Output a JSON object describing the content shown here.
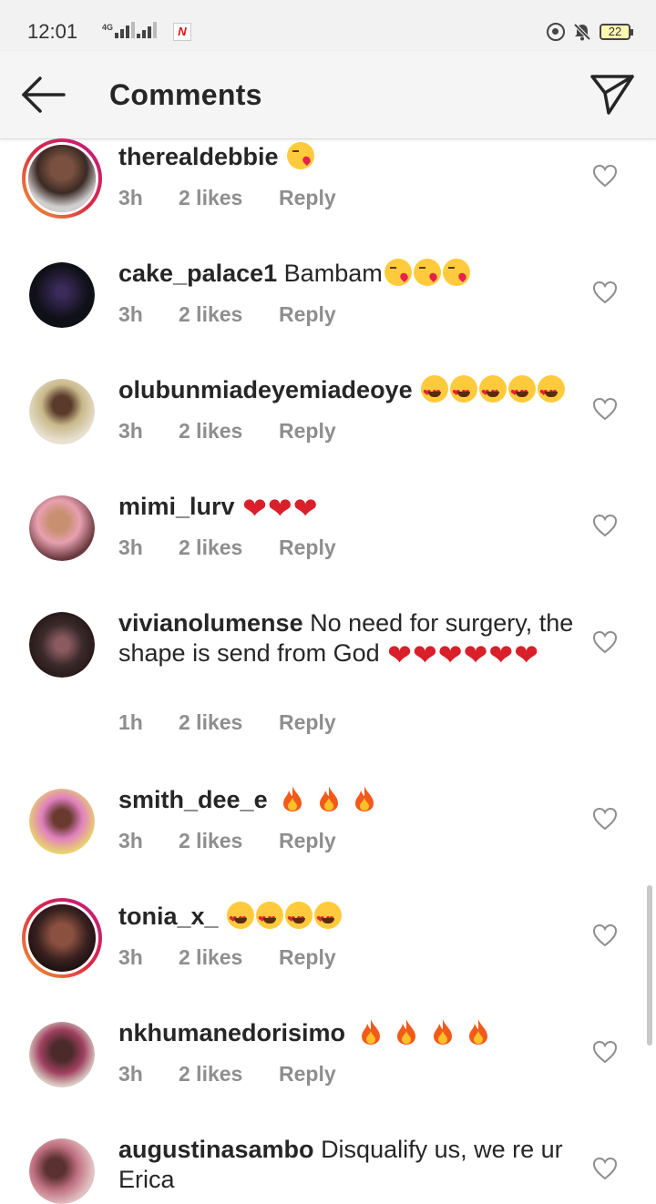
{
  "status_bar": {
    "time": "12:01",
    "network": "4G",
    "battery": "22"
  },
  "header": {
    "title": "Comments"
  },
  "reply_label": "Reply",
  "comments": [
    {
      "username": "therealdebbie",
      "text": "",
      "time": "3h",
      "likes": "2 likes"
    },
    {
      "username": "cake_palace1",
      "text": "Bambam",
      "time": "3h",
      "likes": "2 likes"
    },
    {
      "username": "olubunmiadeyemiadeoye",
      "text": "",
      "time": "3h",
      "likes": "2 likes"
    },
    {
      "username": "mimi_lurv",
      "text": "",
      "time": "3h",
      "likes": "2 likes"
    },
    {
      "username": "vivianolumense",
      "text": "No need for surgery, the shape is send from God",
      "time": "1h",
      "likes": "2 likes"
    },
    {
      "username": "smith_dee_e",
      "text": "",
      "time": "3h",
      "likes": "2 likes"
    },
    {
      "username": "tonia_x_",
      "text": "",
      "time": "3h",
      "likes": "2 likes"
    },
    {
      "username": "nkhumanedorisimo",
      "text": "",
      "time": "3h",
      "likes": "2 likes"
    },
    {
      "username": "augustinasambo",
      "text": "Disqualify us, we re ur Erica",
      "time": "",
      "likes": ""
    }
  ],
  "colors": {
    "meta_gray": "#8e8e8e",
    "text": "#262626",
    "heart_red": "#d91f2a",
    "story_ring": "#dc2743"
  },
  "icons": [
    "back-arrow-icon",
    "direct-send-icon",
    "like-heart-icon",
    "kiss-emoji-icon",
    "heart-eyes-emoji-icon",
    "red-heart-emoji-icon",
    "fire-emoji-icon"
  ]
}
